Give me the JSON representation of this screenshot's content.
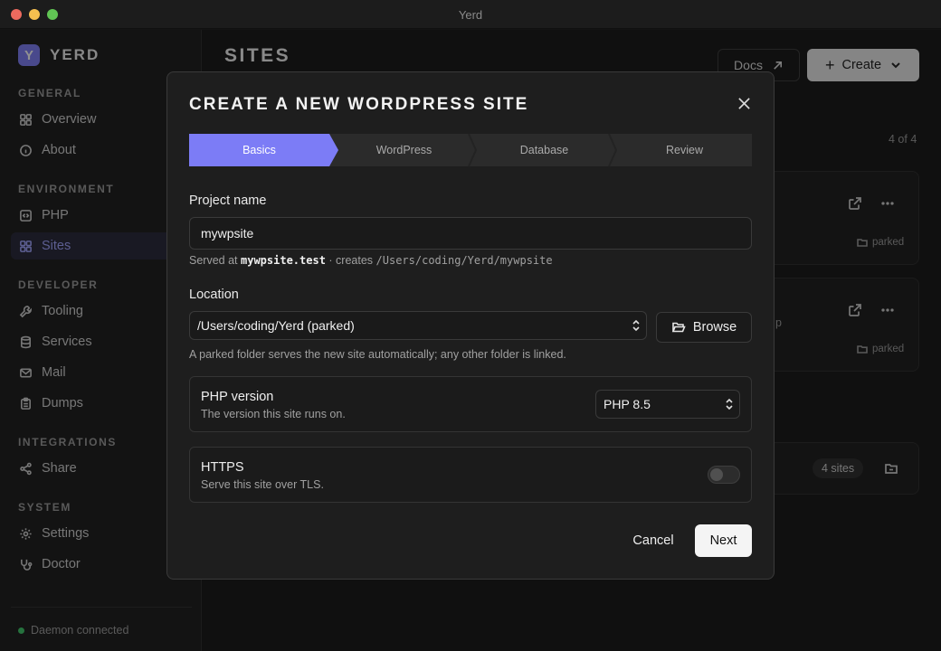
{
  "window": {
    "title": "Yerd"
  },
  "brand": {
    "logo_letter": "Y",
    "name": "YERD"
  },
  "sidebar": {
    "sections": [
      {
        "label": "GENERAL",
        "items": [
          {
            "label": "Overview",
            "icon": "grid-icon"
          },
          {
            "label": "About",
            "icon": "info-icon"
          }
        ]
      },
      {
        "label": "ENVIRONMENT",
        "items": [
          {
            "label": "PHP",
            "icon": "code-icon"
          },
          {
            "label": "Sites",
            "icon": "grid-icon",
            "active": true
          }
        ]
      },
      {
        "label": "DEVELOPER",
        "items": [
          {
            "label": "Tooling",
            "icon": "wrench-icon"
          },
          {
            "label": "Services",
            "icon": "database-icon"
          },
          {
            "label": "Mail",
            "icon": "mail-icon"
          },
          {
            "label": "Dumps",
            "icon": "clipboard-icon"
          }
        ]
      },
      {
        "label": "INTEGRATIONS",
        "items": [
          {
            "label": "Share",
            "icon": "share-icon"
          }
        ]
      },
      {
        "label": "SYSTEM",
        "items": [
          {
            "label": "Settings",
            "icon": "gear-icon"
          },
          {
            "label": "Doctor",
            "icon": "stethoscope-icon"
          }
        ]
      }
    ],
    "status": "Daemon connected"
  },
  "main": {
    "title": "SITES",
    "docs_label": "Docs",
    "create_label": "Create",
    "count": "4 of 4",
    "cards": [
      {
        "tag": "parked"
      },
      {
        "tag": "parked",
        "trail": "p"
      }
    ],
    "group_pill": "4 sites"
  },
  "modal": {
    "title": "CREATE A NEW WORDPRESS SITE",
    "steps": [
      {
        "label": "Basics",
        "active": true
      },
      {
        "label": "WordPress",
        "active": false
      },
      {
        "label": "Database",
        "active": false
      },
      {
        "label": "Review",
        "active": false
      }
    ],
    "project": {
      "label": "Project name",
      "value": "mywpsite",
      "hint_prefix": "Served at",
      "hint_domain": "mywpsite.test",
      "hint_middle": "· creates",
      "hint_path": "/Users/coding/Yerd/mywpsite"
    },
    "location": {
      "label": "Location",
      "selected": "/Users/coding/Yerd (parked)",
      "browse_label": "Browse",
      "hint": "A parked folder serves the new site automatically; any other folder is linked."
    },
    "php": {
      "title": "PHP version",
      "desc": "The version this site runs on.",
      "selected": "PHP 8.5"
    },
    "https": {
      "title": "HTTPS",
      "desc": "Serve this site over TLS.",
      "enabled": false
    },
    "cancel_label": "Cancel",
    "next_label": "Next"
  },
  "colors": {
    "accent": "#7c7cf6",
    "status_ok": "#3cc768"
  }
}
